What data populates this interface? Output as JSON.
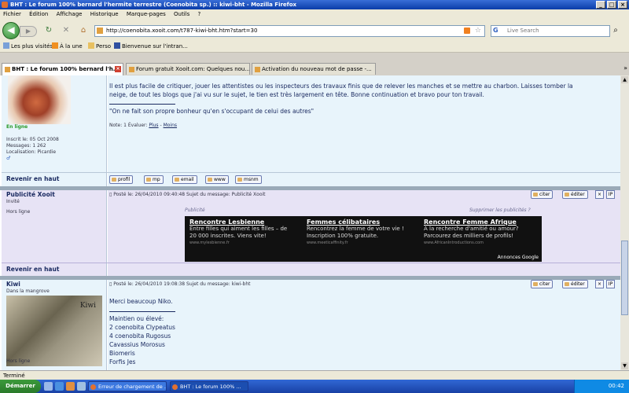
{
  "window": {
    "title": "BHT : Le forum 100% bernard l'hermite terrestre (Coenobita sp.) :: kiwi-bht - Mozilla Firefox",
    "controls": [
      "_",
      "□",
      "×"
    ]
  },
  "menu": [
    "Fichier",
    "Édition",
    "Affichage",
    "Historique",
    "Marque-pages",
    "Outils",
    "?"
  ],
  "nav": {
    "url": "http://coenobita.xooit.com/t787-kiwi-bht.htm?start=30",
    "search_placeholder": "Live Search",
    "search_engine": "G"
  },
  "bookmarks": [
    "Les plus visités",
    "À la une",
    "Perso",
    "Bienvenue sur l'intran..."
  ],
  "tabs": [
    {
      "label": "BHT : Le forum 100% bernard l'h...",
      "active": true
    },
    {
      "label": "Forum gratuit Xooit.com: Quelques nou...",
      "active": false
    },
    {
      "label": "Activation du nouveau mot de passe -...",
      "active": false
    }
  ],
  "post1": {
    "status": "En ligne",
    "inscrit": "Inscrit le: 05 Oct 2008",
    "messages": "Messages: 1 262",
    "localisation": "Localisation: Picardie",
    "text1": "Il est plus facile de critiquer, jouer les attentistes ou les inspecteurs des travaux finis que de relever les manches et se mettre au charbon. Laisses tomber la",
    "text2": "neige, de tout les blogs que j'ai vu sur le sujet, le tien est très largement en tête. Bonne continuation et bravo pour ton travail.",
    "signature": "\"On ne fait son propre bonheur qu'en s'occupant de celui des autres\"",
    "note": "Note: 1  Évaluer:",
    "plus": "Plus",
    "dash": "-",
    "moins": "Moins",
    "back": "Revenir en haut",
    "buttons": [
      "profil",
      "mp",
      "email",
      "www",
      "msnm"
    ]
  },
  "pub": {
    "author": "Publicité Xooit",
    "rank": "Invité",
    "status": "Hors ligne",
    "header": "Posté le: 26/04/2010 09:40:48    Sujet du message: Publicité Xooit",
    "label": "Publicité",
    "remove": "Supprimer les publicités ?",
    "back": "Revenir en haut",
    "actions": [
      "citer",
      "éditer",
      "×",
      "IP"
    ],
    "ads": [
      {
        "title": "Rencontre Lesbienne",
        "l1": "Entre filles qui aiment les filles – de",
        "l2": "20 000 inscrites. Viens vite!",
        "url": "www.mylesbienne.fr"
      },
      {
        "title": "Femmes célibataires",
        "l1": "Rencontrez la femme de votre vie !",
        "l2": "Inscription 100% gratuite.",
        "url": "www.meeticaffinity.fr"
      },
      {
        "title": "Rencontre Femme Afrique",
        "l1": "A la recherche d'amitié ou amour?",
        "l2": "Parcourez des milliers de profils!",
        "url": "www.AfricanIntroductions.com"
      }
    ],
    "adsby": "Annonces Google"
  },
  "post2": {
    "author": "Kiwi",
    "rank": "Dans la mangrove",
    "avatar_label": "Kiwi",
    "status": "Hors ligne",
    "header": "Posté le: 26/04/2010 19:08:38    Sujet du message: kiwi-bht",
    "actions": [
      "citer",
      "éditer",
      "×",
      "IP"
    ],
    "lines": [
      "Merci beaucoup Niko.",
      "Maintien ou élevé:",
      "2 coenobita Clypeatus",
      "4 coenobita Rugosus",
      "Cavassius Morosus",
      "Biomeris",
      "Forfis Jes"
    ]
  },
  "status": "Terminé",
  "taskbar": {
    "start": "Démarrer",
    "tasks": [
      {
        "label": "Erreur de chargement de ...",
        "active": false
      },
      {
        "label": "BHT : Le forum 100% ...",
        "active": true
      }
    ],
    "clock": "00:42"
  }
}
